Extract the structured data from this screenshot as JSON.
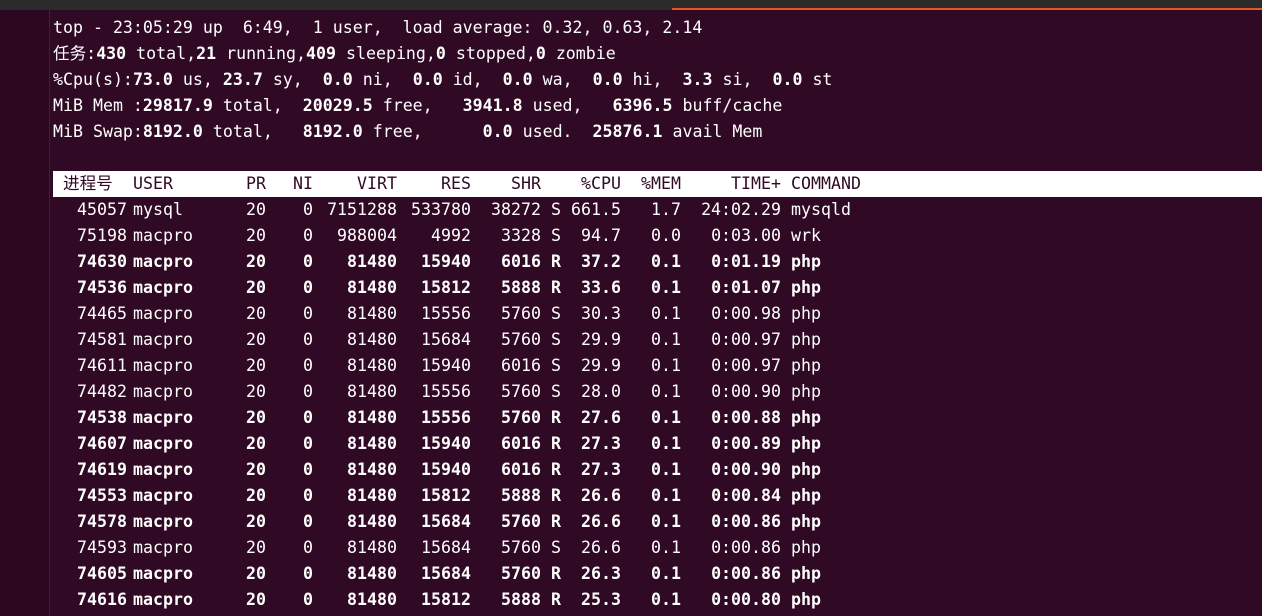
{
  "summary": {
    "uptime_line": "top - 23:05:29 up  6:49,  1 user,  load average: 0.32, 0.63, 2.14",
    "tasks": {
      "label": "任务:",
      "total": "430",
      "total_label": " total,",
      "running": "21",
      "running_label": " running,",
      "sleeping": "409",
      "sleeping_label": " sleeping,",
      "stopped": "0",
      "stopped_label": " stopped,",
      "zombie": "0",
      "zombie_label": " zombie"
    },
    "cpu": {
      "label": "%Cpu(s):",
      "us": "73.0",
      "sy": "23.7",
      "ni": "0.0",
      "id": "0.0",
      "wa": "0.0",
      "hi": "0.0",
      "si": "3.3",
      "st": "0.0"
    },
    "mem": {
      "label": "MiB Mem :",
      "total": "29817.9",
      "free": "20029.5",
      "used": "3941.8",
      "buff_cache": "6396.5"
    },
    "swap": {
      "label": "MiB Swap:",
      "total": "8192.0",
      "free": "8192.0",
      "used": "0.0",
      "avail_mem": "25876.1"
    }
  },
  "table": {
    "columns": [
      "进程号",
      "USER",
      "PR",
      "NI",
      "VIRT",
      "RES",
      "SHR",
      "",
      "%CPU",
      "%MEM",
      "TIME+",
      "COMMAND"
    ],
    "rows": [
      {
        "pid": "45057",
        "user": "mysql",
        "pr": "20",
        "ni": "0",
        "virt": "7151288",
        "res": "533780",
        "shr": "38272",
        "s": "S",
        "cpu": "661.5",
        "mem": "1.7",
        "time": "24:02.29",
        "cmd": "mysqld",
        "bold": false
      },
      {
        "pid": "75198",
        "user": "macpro",
        "pr": "20",
        "ni": "0",
        "virt": "988004",
        "res": "4992",
        "shr": "3328",
        "s": "S",
        "cpu": "94.7",
        "mem": "0.0",
        "time": "0:03.00",
        "cmd": "wrk",
        "bold": false
      },
      {
        "pid": "74630",
        "user": "macpro",
        "pr": "20",
        "ni": "0",
        "virt": "81480",
        "res": "15940",
        "shr": "6016",
        "s": "R",
        "cpu": "37.2",
        "mem": "0.1",
        "time": "0:01.19",
        "cmd": "php",
        "bold": true
      },
      {
        "pid": "74536",
        "user": "macpro",
        "pr": "20",
        "ni": "0",
        "virt": "81480",
        "res": "15812",
        "shr": "5888",
        "s": "R",
        "cpu": "33.6",
        "mem": "0.1",
        "time": "0:01.07",
        "cmd": "php",
        "bold": true
      },
      {
        "pid": "74465",
        "user": "macpro",
        "pr": "20",
        "ni": "0",
        "virt": "81480",
        "res": "15556",
        "shr": "5760",
        "s": "S",
        "cpu": "30.3",
        "mem": "0.1",
        "time": "0:00.98",
        "cmd": "php",
        "bold": false
      },
      {
        "pid": "74581",
        "user": "macpro",
        "pr": "20",
        "ni": "0",
        "virt": "81480",
        "res": "15684",
        "shr": "5760",
        "s": "S",
        "cpu": "29.9",
        "mem": "0.1",
        "time": "0:00.97",
        "cmd": "php",
        "bold": false
      },
      {
        "pid": "74611",
        "user": "macpro",
        "pr": "20",
        "ni": "0",
        "virt": "81480",
        "res": "15940",
        "shr": "6016",
        "s": "S",
        "cpu": "29.9",
        "mem": "0.1",
        "time": "0:00.97",
        "cmd": "php",
        "bold": false
      },
      {
        "pid": "74482",
        "user": "macpro",
        "pr": "20",
        "ni": "0",
        "virt": "81480",
        "res": "15556",
        "shr": "5760",
        "s": "S",
        "cpu": "28.0",
        "mem": "0.1",
        "time": "0:00.90",
        "cmd": "php",
        "bold": false
      },
      {
        "pid": "74538",
        "user": "macpro",
        "pr": "20",
        "ni": "0",
        "virt": "81480",
        "res": "15556",
        "shr": "5760",
        "s": "R",
        "cpu": "27.6",
        "mem": "0.1",
        "time": "0:00.88",
        "cmd": "php",
        "bold": true
      },
      {
        "pid": "74607",
        "user": "macpro",
        "pr": "20",
        "ni": "0",
        "virt": "81480",
        "res": "15940",
        "shr": "6016",
        "s": "R",
        "cpu": "27.3",
        "mem": "0.1",
        "time": "0:00.89",
        "cmd": "php",
        "bold": true
      },
      {
        "pid": "74619",
        "user": "macpro",
        "pr": "20",
        "ni": "0",
        "virt": "81480",
        "res": "15940",
        "shr": "6016",
        "s": "R",
        "cpu": "27.3",
        "mem": "0.1",
        "time": "0:00.90",
        "cmd": "php",
        "bold": true
      },
      {
        "pid": "74553",
        "user": "macpro",
        "pr": "20",
        "ni": "0",
        "virt": "81480",
        "res": "15812",
        "shr": "5888",
        "s": "R",
        "cpu": "26.6",
        "mem": "0.1",
        "time": "0:00.84",
        "cmd": "php",
        "bold": true
      },
      {
        "pid": "74578",
        "user": "macpro",
        "pr": "20",
        "ni": "0",
        "virt": "81480",
        "res": "15684",
        "shr": "5760",
        "s": "R",
        "cpu": "26.6",
        "mem": "0.1",
        "time": "0:00.86",
        "cmd": "php",
        "bold": true
      },
      {
        "pid": "74593",
        "user": "macpro",
        "pr": "20",
        "ni": "0",
        "virt": "81480",
        "res": "15684",
        "shr": "5760",
        "s": "S",
        "cpu": "26.6",
        "mem": "0.1",
        "time": "0:00.86",
        "cmd": "php",
        "bold": false
      },
      {
        "pid": "74605",
        "user": "macpro",
        "pr": "20",
        "ni": "0",
        "virt": "81480",
        "res": "15684",
        "shr": "5760",
        "s": "R",
        "cpu": "26.3",
        "mem": "0.1",
        "time": "0:00.86",
        "cmd": "php",
        "bold": true
      },
      {
        "pid": "74616",
        "user": "macpro",
        "pr": "20",
        "ni": "0",
        "virt": "81480",
        "res": "15812",
        "shr": "5888",
        "s": "R",
        "cpu": "25.3",
        "mem": "0.1",
        "time": "0:00.80",
        "cmd": "php",
        "bold": true
      }
    ]
  },
  "colors": {
    "background": "#300a24",
    "foreground": "#ffffff",
    "accent": "#e95420"
  }
}
